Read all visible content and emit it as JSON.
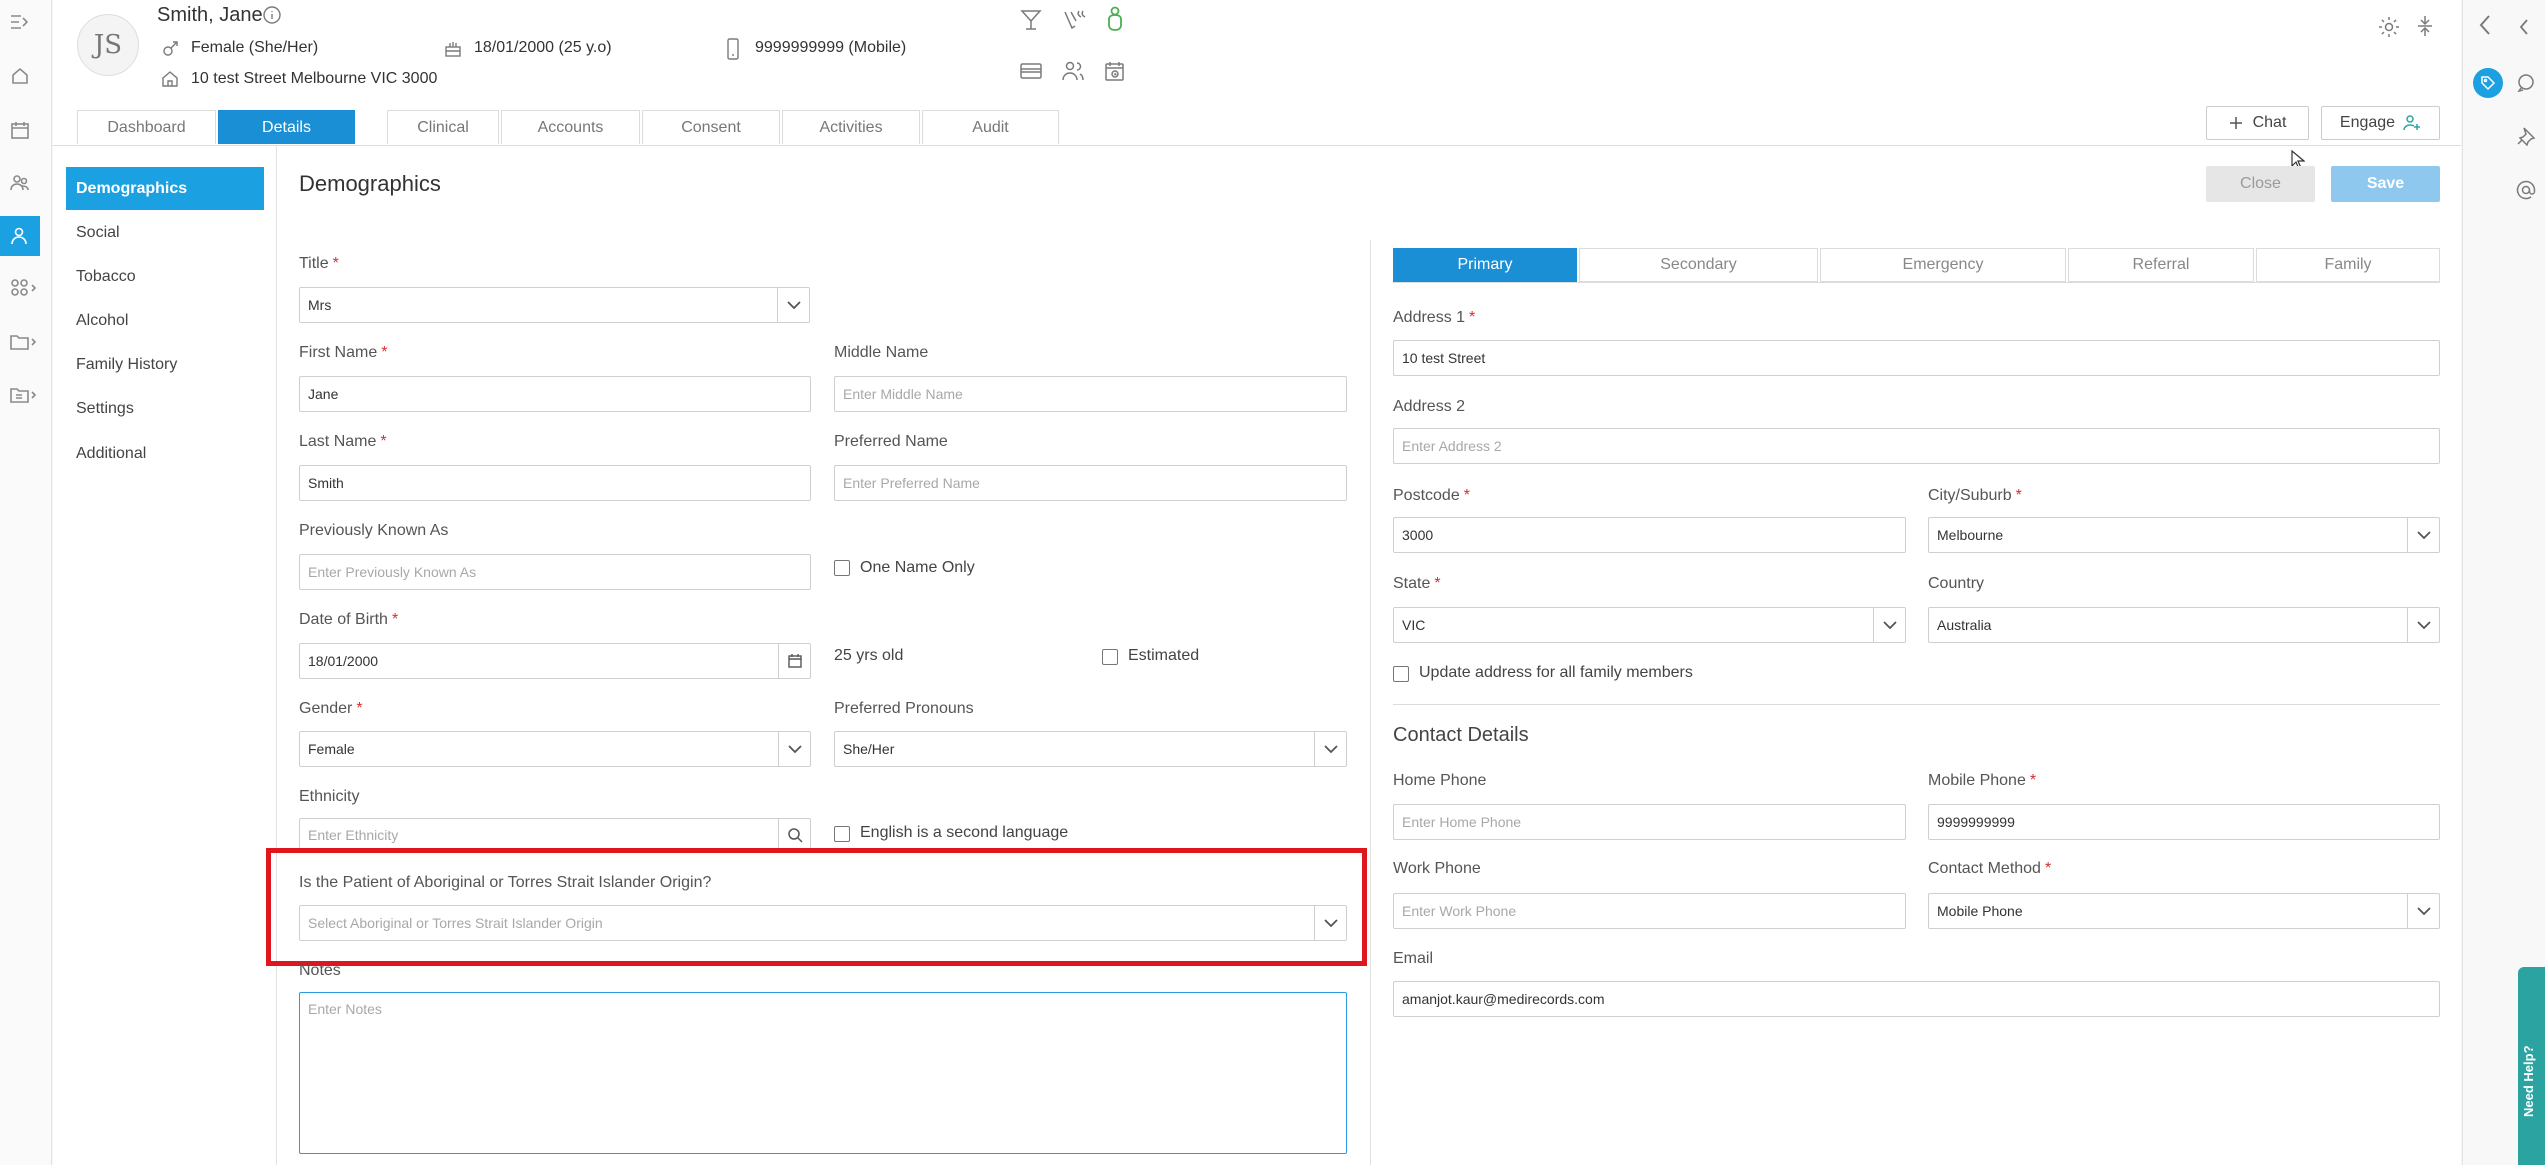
{
  "patient": {
    "initials": "JS",
    "name": "Smith, Jane",
    "gender": "Female (She/Her)",
    "dob": "18/01/2000 (25 y.o)",
    "phone": "9999999999 (Mobile)",
    "address": "10 test Street Melbourne VIC 3000"
  },
  "tabs": [
    "Dashboard",
    "Details",
    "Clinical",
    "Accounts",
    "Consent",
    "Activities",
    "Audit"
  ],
  "active_tab": "Details",
  "header_buttons": {
    "chat": "Chat",
    "engage": "Engage"
  },
  "sidebar": [
    "Demographics",
    "Social",
    "Tobacco",
    "Alcohol",
    "Family History",
    "Settings",
    "Additional"
  ],
  "page": {
    "title": "Demographics",
    "close": "Close",
    "save": "Save"
  },
  "form": {
    "title": {
      "label": "Title",
      "value": "Mrs"
    },
    "first_name": {
      "label": "First Name",
      "value": "Jane"
    },
    "middle_name": {
      "label": "Middle Name",
      "placeholder": "Enter Middle Name"
    },
    "last_name": {
      "label": "Last Name",
      "value": "Smith"
    },
    "preferred_name": {
      "label": "Preferred Name",
      "placeholder": "Enter Preferred Name"
    },
    "previously_known_as": {
      "label": "Previously Known As",
      "placeholder": "Enter Previously Known As"
    },
    "one_name_only": "One Name Only",
    "dob": {
      "label": "Date of Birth",
      "value": "18/01/2000"
    },
    "age_text": "25 yrs old",
    "estimated": "Estimated",
    "gender": {
      "label": "Gender",
      "value": "Female"
    },
    "pronouns": {
      "label": "Preferred Pronouns",
      "value": "She/Her"
    },
    "ethnicity": {
      "label": "Ethnicity",
      "placeholder": "Enter Ethnicity"
    },
    "english_second": "English is a second language",
    "aboriginal": {
      "label": "Is the Patient of Aboriginal or Torres Strait Islander Origin?",
      "placeholder": "Select Aboriginal or Torres Strait Islander Origin"
    },
    "notes": {
      "label": "Notes",
      "placeholder": "Enter Notes"
    }
  },
  "address_tabs": [
    "Primary",
    "Secondary",
    "Emergency",
    "Referral",
    "Family"
  ],
  "address": {
    "address1": {
      "label": "Address 1",
      "value": "10 test Street"
    },
    "address2": {
      "label": "Address 2",
      "placeholder": "Enter Address 2"
    },
    "postcode": {
      "label": "Postcode",
      "value": "3000"
    },
    "city": {
      "label": "City/Suburb",
      "value": "Melbourne"
    },
    "state": {
      "label": "State",
      "value": "VIC"
    },
    "country": {
      "label": "Country",
      "value": "Australia"
    },
    "update_all": "Update address for all family members"
  },
  "contact": {
    "title": "Contact Details",
    "home_phone": {
      "label": "Home Phone",
      "placeholder": "Enter Home Phone"
    },
    "mobile_phone": {
      "label": "Mobile Phone",
      "value": "9999999999"
    },
    "work_phone": {
      "label": "Work Phone",
      "placeholder": "Enter Work Phone"
    },
    "contact_method": {
      "label": "Contact Method",
      "value": "Mobile Phone"
    },
    "email": {
      "label": "Email",
      "value": "amanjot.kaur@medirecords.com"
    }
  },
  "need_help": "Need Help?",
  "colors": {
    "accent": "#1b8fd6",
    "highlight": "#e0161e",
    "required": "#d32f2f",
    "ok": "#4caf50"
  }
}
